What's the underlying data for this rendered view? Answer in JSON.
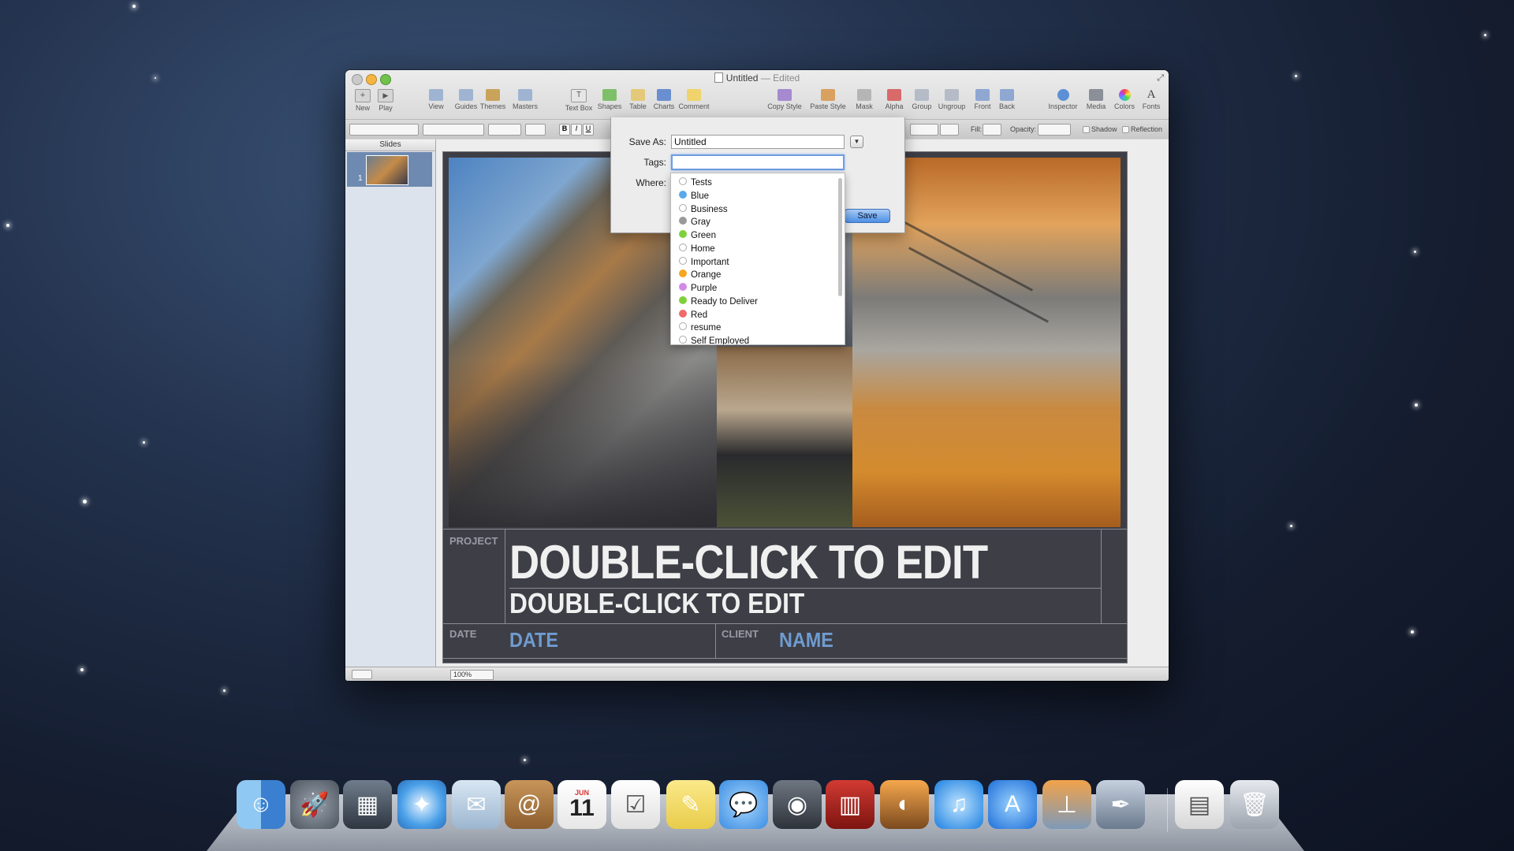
{
  "window": {
    "title": "Untitled",
    "edited": "— Edited"
  },
  "toolbar": {
    "new": "New",
    "play": "Play",
    "view": "View",
    "guides": "Guides",
    "themes": "Themes",
    "masters": "Masters",
    "text_box": "Text Box",
    "shapes": "Shapes",
    "table": "Table",
    "charts": "Charts",
    "comment": "Comment",
    "copy_style": "Copy Style",
    "paste_style": "Paste Style",
    "mask": "Mask",
    "alpha": "Alpha",
    "group": "Group",
    "ungroup": "Ungroup",
    "front": "Front",
    "back": "Back",
    "inspector": "Inspector",
    "media": "Media",
    "colors": "Colors",
    "fonts": "Fonts"
  },
  "format_bar": {
    "fill": "Fill:",
    "opacity": "Opacity:",
    "shadow": "Shadow",
    "reflection": "Reflection",
    "bold": "B",
    "italic": "I",
    "underline": "U"
  },
  "sidebar": {
    "heading": "Slides",
    "slide_number": "1"
  },
  "status": {
    "zoom": "100%"
  },
  "slide": {
    "project_label": "PROJECT",
    "title": "DOUBLE-CLICK TO EDIT",
    "subtitle": "DOUBLE-CLICK TO EDIT",
    "date_label": "DATE",
    "date_value": "DATE",
    "client_label": "CLIENT",
    "client_value": "NAME"
  },
  "save_sheet": {
    "save_as_label": "Save As:",
    "save_as_value": "Untitled",
    "tags_label": "Tags:",
    "tags_value": "",
    "where_label": "Where:",
    "save_button": "Save"
  },
  "tags": [
    {
      "label": "Tests",
      "color": ""
    },
    {
      "label": "Blue",
      "color": "#5aa9ea"
    },
    {
      "label": "Business",
      "color": ""
    },
    {
      "label": "Gray",
      "color": "#9a9a9a"
    },
    {
      "label": "Green",
      "color": "#7fd13b"
    },
    {
      "label": "Home",
      "color": ""
    },
    {
      "label": "Important",
      "color": ""
    },
    {
      "label": "Orange",
      "color": "#f5a623"
    },
    {
      "label": "Purple",
      "color": "#d28ae8"
    },
    {
      "label": "Ready to Deliver",
      "color": "#7fd13b"
    },
    {
      "label": "Red",
      "color": "#ef6a6a"
    },
    {
      "label": "resume",
      "color": ""
    },
    {
      "label": "Self Employed",
      "color": ""
    }
  ],
  "dock": {
    "items": [
      "finder-icon",
      "launchpad-icon",
      "mission-control-icon",
      "safari-icon",
      "mail-icon",
      "contacts-icon",
      "calendar-icon",
      "reminders-icon",
      "notes-icon",
      "messages-icon",
      "facetime-icon",
      "photo-booth-icon",
      "iphoto-icon",
      "itunes-icon",
      "app-store-icon",
      "keynote-icon",
      "preview-icon",
      "document-icon",
      "trash-icon"
    ],
    "calendar_day": "11",
    "calendar_month": "JUN"
  }
}
